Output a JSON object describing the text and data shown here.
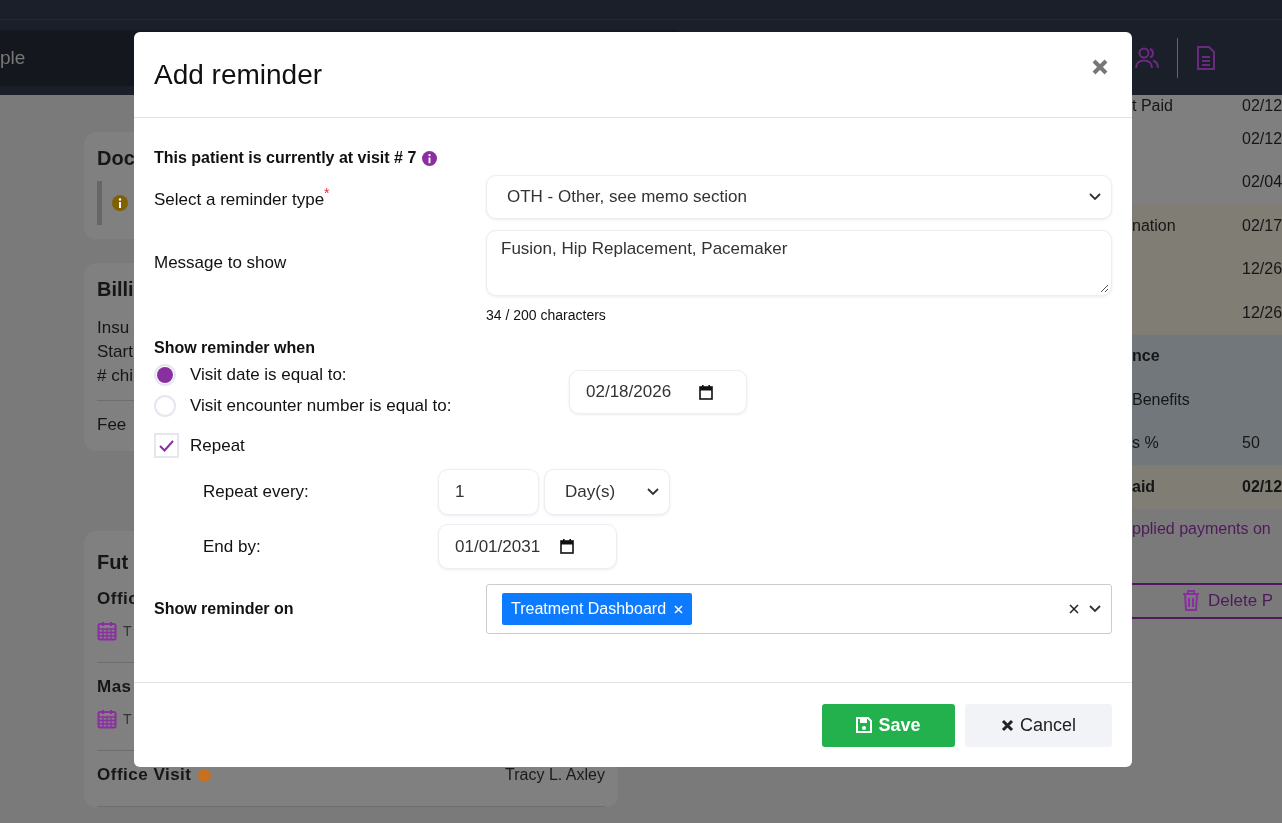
{
  "app_header": {
    "search_text": "ple"
  },
  "left_cards": {
    "docs": {
      "title": "Doc"
    },
    "billing": {
      "title": "Billi",
      "lines": [
        "Insu",
        "Start",
        "# chi"
      ],
      "fee": "Fee"
    },
    "future": {
      "title": "Fut",
      "appointments": [
        {
          "title": "Offic",
          "date": "T"
        },
        {
          "title": "Mas",
          "date": "T"
        },
        {
          "title": "Office Visit",
          "color": "#c8701e",
          "provider": "Tracy L. Axley"
        }
      ]
    }
  },
  "right_table": {
    "rows": [
      {
        "label": "t Paid",
        "value": "02/12",
        "color": "#7f7f7f",
        "kind": "plain"
      },
      {
        "value": "02/12",
        "color": "#7f7f7f",
        "kind": "plain"
      },
      {
        "value": "02/04",
        "color": "#7f7f7f",
        "kind": "plain"
      },
      {
        "label": "nation",
        "value": "02/17",
        "color": "#7f7d74",
        "kind": "plain"
      },
      {
        "value": "12/26",
        "color": "#7f7d74",
        "kind": "plain"
      },
      {
        "value": "12/26",
        "color": "#7f7d74",
        "kind": "plain"
      },
      {
        "label": "nce",
        "color": "#72777b",
        "kind": "heading"
      },
      {
        "label": "Benefits",
        "color": "#72777b",
        "kind": "plain"
      },
      {
        "label": "s %",
        "value": "50",
        "color": "#72777b",
        "kind": "plain"
      },
      {
        "label": "aid",
        "value": "02/12",
        "color": "#7f7d74",
        "kind": "heading"
      }
    ],
    "link": "pplied payments on",
    "delete_button": "Delete P"
  },
  "modal": {
    "title": "Add reminder",
    "visit_note": "This patient is currently at visit # 7",
    "reminder_type": {
      "label": "Select a reminder type",
      "required_mark": "*",
      "value": "OTH - Other, see memo section"
    },
    "message": {
      "label": "Message to show",
      "value": "Fusion, Hip Replacement, Pacemaker",
      "counter": "34 / 200 characters"
    },
    "show_when": {
      "heading": "Show reminder when",
      "options": [
        {
          "label": "Visit date is equal to:",
          "selected": true
        },
        {
          "label": "Visit encounter number is equal to:",
          "selected": false
        }
      ],
      "date": "02/18/2026"
    },
    "repeat": {
      "label": "Repeat",
      "checked": true,
      "every_label": "Repeat every:",
      "every_value": "1",
      "unit": "Day(s)",
      "end_label": "End by:",
      "end_value": "01/01/2031"
    },
    "show_on": {
      "label": "Show reminder on",
      "tags": [
        "Treatment Dashboard"
      ]
    },
    "buttons": [
      {
        "label": "Save",
        "kind": "primary"
      },
      {
        "label": "Cancel",
        "kind": "secondary"
      }
    ]
  }
}
